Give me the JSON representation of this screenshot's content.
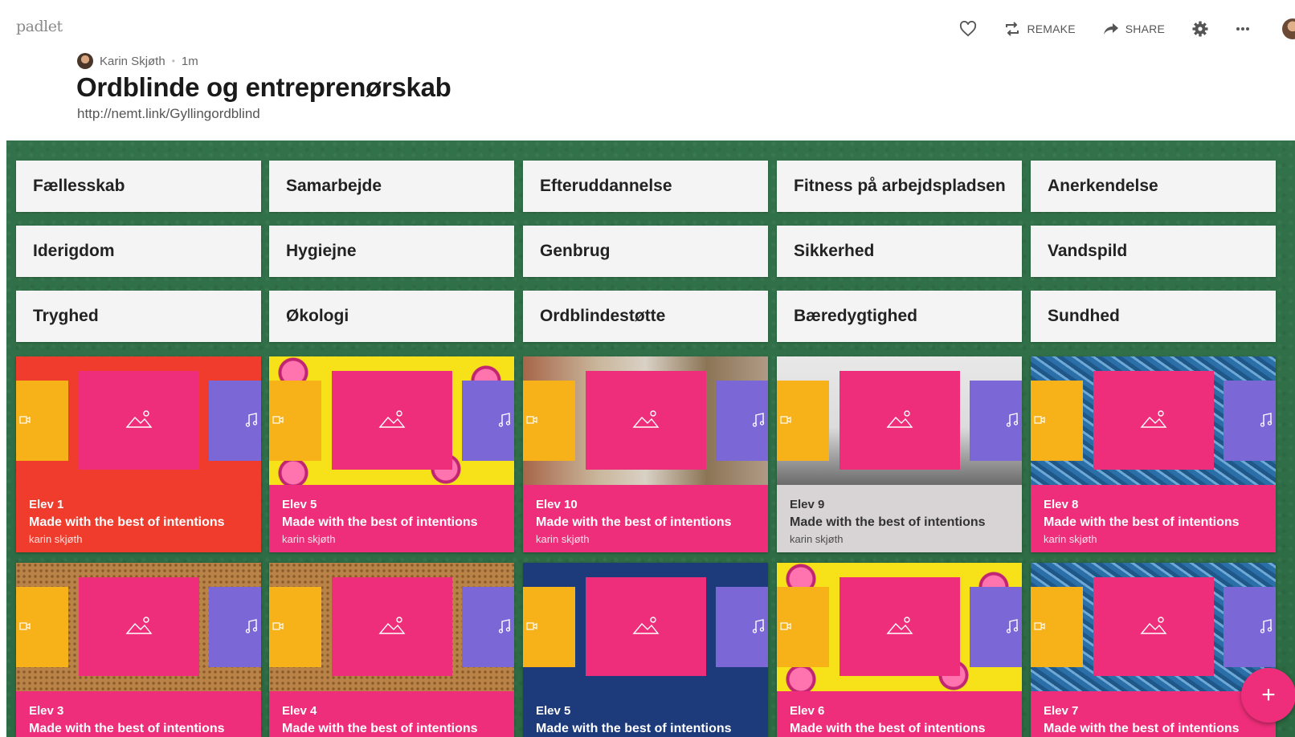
{
  "app": {
    "logo": "padlet"
  },
  "toolbar": {
    "remake_label": "REMAKE",
    "share_label": "SHARE"
  },
  "header": {
    "author": "Karin Skjøth",
    "time_ago": "1m",
    "separator": "•",
    "title": "Ordblinde og entreprenørskab",
    "subtitle": "http://nemt.link/Gyllingordblind"
  },
  "labels": [
    [
      "Fællesskab",
      "Samarbejde",
      "Efteruddannelse",
      "Fitness på arbejdspladsen",
      "Anerkendelse"
    ],
    [
      "Iderigdom",
      "Hygiejne",
      "Genbrug",
      "Sikkerhed",
      "Vandspild"
    ],
    [
      "Tryghed",
      "Økologi",
      "Ordblindestøtte",
      "Bæredygtighed",
      "Sundhed"
    ]
  ],
  "posts": [
    [
      {
        "title": "Elev 1",
        "subtitle": "Made with the best of intentions",
        "author": "karin skjøth",
        "theme": "red"
      },
      {
        "title": "Elev 5",
        "subtitle": "Made with the best of intentions",
        "author": "karin skjøth",
        "theme": "donut"
      },
      {
        "title": "Elev 10",
        "subtitle": "Made with the best of intentions",
        "author": "karin skjøth",
        "theme": "forest"
      },
      {
        "title": "Elev 9",
        "subtitle": "Made with the best of intentions",
        "author": "karin skjøth",
        "theme": "city"
      },
      {
        "title": "Elev 8",
        "subtitle": "Made with the best of intentions",
        "author": "karin skjøth",
        "theme": "water"
      }
    ],
    [
      {
        "title": "Elev 3",
        "subtitle": "Made with the best of intentions",
        "author": "",
        "theme": "cork"
      },
      {
        "title": "Elev 4",
        "subtitle": "Made with the best of intentions",
        "author": "",
        "theme": "cork"
      },
      {
        "title": "Elev 5",
        "subtitle": "Made with the best of intentions",
        "author": "",
        "theme": "navy"
      },
      {
        "title": "Elev 6",
        "subtitle": "Made with the best of intentions",
        "author": "",
        "theme": "donut"
      },
      {
        "title": "Elev 7",
        "subtitle": "Made with the best of intentions",
        "author": "",
        "theme": "water"
      }
    ]
  ],
  "fab": {
    "label": "+"
  },
  "colors": {
    "board": "#2f6f45",
    "pink": "#ee2e7a",
    "red": "#ef3c2d",
    "yellow": "#f7b21a",
    "violet": "#7b68d6",
    "navy": "#1d3a7a",
    "grey": "#d8d4d6"
  },
  "icons": [
    "heart-icon",
    "remake-icon",
    "share-icon",
    "gear-icon",
    "more-icon",
    "user-avatar",
    "video-icon",
    "image-icon",
    "music-icon",
    "plus-icon"
  ]
}
